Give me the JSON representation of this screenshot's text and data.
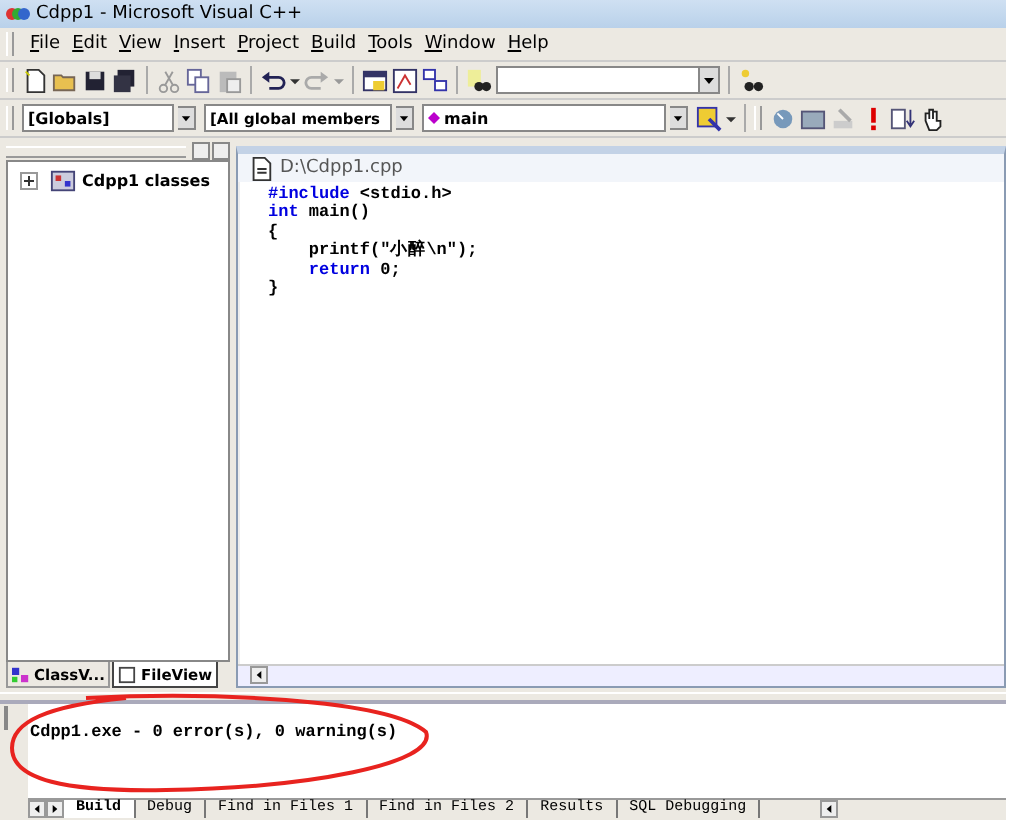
{
  "window": {
    "title": "Cdpp1 - Microsoft Visual C++"
  },
  "menu": [
    {
      "label": "File"
    },
    {
      "label": "Edit"
    },
    {
      "label": "View"
    },
    {
      "label": "Insert"
    },
    {
      "label": "Project"
    },
    {
      "label": "Build"
    },
    {
      "label": "Tools"
    },
    {
      "label": "Window"
    },
    {
      "label": "Help"
    }
  ],
  "wizard_bar": {
    "scope": "[Globals]",
    "members": "[All global members",
    "function": "main"
  },
  "workspace": {
    "tree": [
      {
        "label": "Cdpp1 classes",
        "expanded": false
      }
    ],
    "tabs": [
      {
        "label": "ClassV...",
        "selected": false,
        "kind": "classes"
      },
      {
        "label": "FileView",
        "selected": true,
        "kind": "files"
      }
    ]
  },
  "editor": {
    "title": "D:\\Cdpp1.cpp",
    "lines": [
      {
        "indented": false,
        "tokens": [
          {
            "kind": "keyword",
            "text": "#include"
          },
          {
            "kind": "plain",
            "text": " <stdio.h>"
          }
        ]
      },
      {
        "indented": false,
        "tokens": [
          {
            "kind": "keyword",
            "text": "int"
          },
          {
            "kind": "plain",
            "text": " main()"
          }
        ]
      },
      {
        "indented": false,
        "tokens": [
          {
            "kind": "plain",
            "text": "{"
          }
        ]
      },
      {
        "indented": true,
        "tokens": [
          {
            "kind": "plain",
            "text": "printf(\"小醉\\n\");"
          }
        ]
      },
      {
        "indented": true,
        "tokens": [
          {
            "kind": "keyword",
            "text": "return"
          },
          {
            "kind": "plain",
            "text": " 0;"
          }
        ]
      },
      {
        "indented": false,
        "tokens": [
          {
            "kind": "plain",
            "text": "}"
          }
        ]
      }
    ]
  },
  "output": {
    "text": "Cdpp1.exe - 0 error(s), 0 warning(s)",
    "tabs": [
      {
        "label": "Build",
        "selected": true
      },
      {
        "label": "Debug",
        "selected": false
      },
      {
        "label": "Find in Files 1",
        "selected": false
      },
      {
        "label": "Find in Files 2",
        "selected": false
      },
      {
        "label": "Results",
        "selected": false
      },
      {
        "label": "SQL Debugging",
        "selected": false
      }
    ]
  },
  "annotation": {
    "kind": "ellipse"
  }
}
